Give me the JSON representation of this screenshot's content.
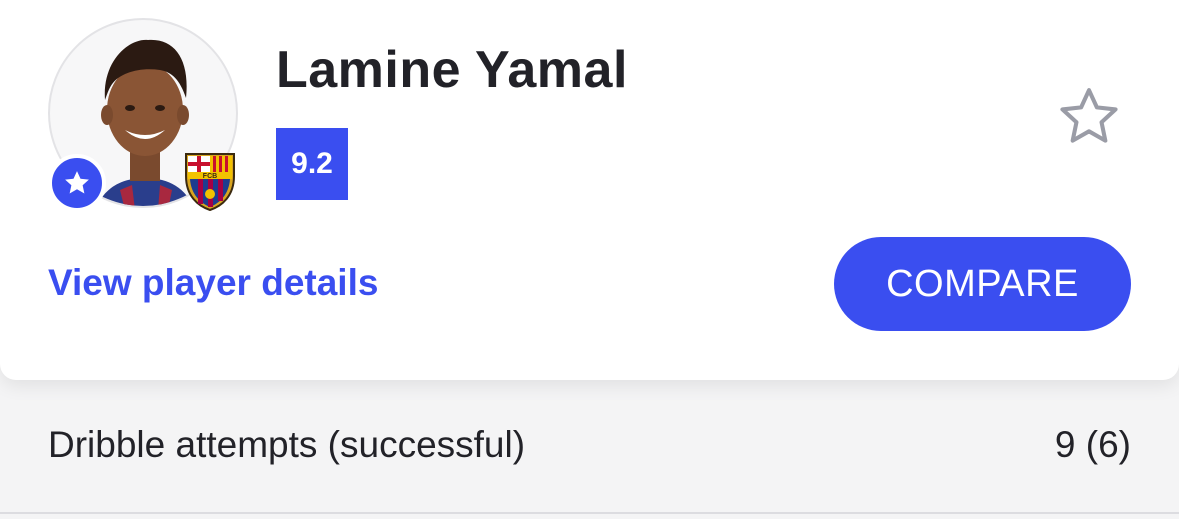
{
  "player": {
    "name": "Lamine Yamal",
    "rating": "9.2",
    "club_crest_text": "FCB"
  },
  "actions": {
    "view_details_label": "View player details",
    "compare_label": "COMPARE"
  },
  "stat": {
    "label": "Dribble attempts (successful)",
    "value": "9 (6)"
  },
  "colors": {
    "accent": "#3a4ef0",
    "text": "#222228",
    "star_outline": "#9a9ca6"
  },
  "icons": {
    "rating_badge": "star-icon",
    "favorite": "star-outline-icon",
    "club": "club-crest-icon"
  }
}
